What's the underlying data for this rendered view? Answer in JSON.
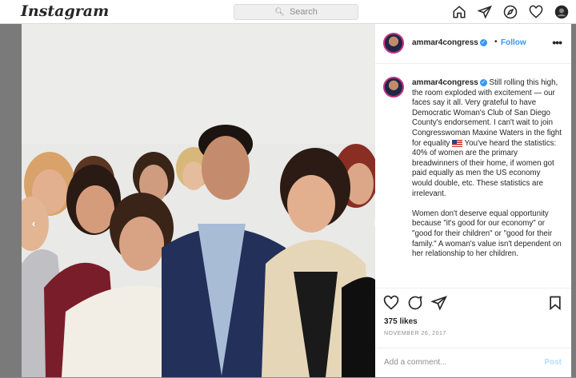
{
  "header": {
    "logo": "Instagram",
    "search_placeholder": "Search"
  },
  "post": {
    "author": "ammar4congress",
    "follow_label": "Follow",
    "follow_separator": "•",
    "caption_author": "ammar4congress",
    "caption_p1": "Still rolling this high, the room exploded with excitement — our faces say it all. Very grateful to have Democratic Woman's Club of San Diego County's endorsement. I can't wait to join Congresswoman Maxine Waters in the fight for equality",
    "caption_p1_tail": "You've heard the statistics: 40% of women are the primary breadwinners of their home, if women got paid equally as men the US economy would double, etc. These statistics are irrelevant.",
    "caption_p2": "Women don't deserve equal opportunity because \"it's good for our economy\" or \"good for their children\" or \"good for their family.\" A woman's value isn't dependent on her relationship to her children.",
    "likes": "375 likes",
    "date": "NOVEMBER 26, 2017",
    "comment_placeholder": "Add a comment...",
    "post_label": "Post"
  },
  "colors": {
    "accent": "#3897f0",
    "post_disabled": "#b2dffc"
  }
}
